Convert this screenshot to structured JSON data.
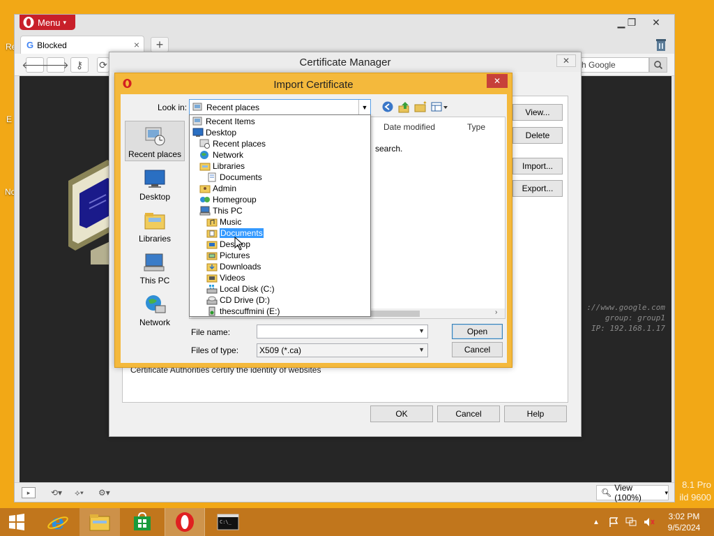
{
  "desktop": {
    "left_edge_labels": [
      "Re",
      "E",
      "No"
    ],
    "watermark": {
      "line1": "8.1 Pro",
      "line2": "ild 9600"
    }
  },
  "browser": {
    "menu_label": "Menu",
    "tab": {
      "title": "Blocked"
    },
    "search": {
      "text": "h Google"
    },
    "content": {
      "terminal_lines": [
        "://www.google.com",
        "group: group1",
        "IP: 192.168.1.17"
      ]
    },
    "statusbar": {
      "zoom_label": "View (100%)"
    }
  },
  "cert_manager": {
    "title": "Certificate Manager",
    "side_buttons": {
      "view": "View...",
      "delete": "Delete",
      "import": "Import...",
      "export": "Export..."
    },
    "description": "Certificate Authorities certify the identity of websites",
    "buttons": {
      "ok": "OK",
      "cancel": "Cancel",
      "help": "Help"
    }
  },
  "import_dialog": {
    "title": "Import Certificate",
    "look_in_label": "Look in:",
    "look_in_value": "Recent places",
    "places": [
      {
        "label": "Recent places",
        "icon": "recent-places-icon"
      },
      {
        "label": "Desktop",
        "icon": "desktop-icon"
      },
      {
        "label": "Libraries",
        "icon": "libraries-icon"
      },
      {
        "label": "This PC",
        "icon": "this-pc-icon"
      },
      {
        "label": "Network",
        "icon": "network-icon"
      }
    ],
    "columns": {
      "date_modified": "Date modified",
      "type": "Type"
    },
    "list_message": "search.",
    "file_name_label": "File name:",
    "file_name_value": "",
    "files_of_type_label": "Files of type:",
    "files_of_type_value": "X509 (*.ca)",
    "buttons": {
      "open": "Open",
      "cancel": "Cancel"
    }
  },
  "look_in_dropdown": {
    "items": [
      {
        "label": "Recent Items",
        "icon": "recent-items-icon",
        "level": 0
      },
      {
        "label": "Desktop",
        "icon": "desktop-icon",
        "level": 0
      },
      {
        "label": "Recent places",
        "icon": "recent-places-icon",
        "level": 1
      },
      {
        "label": "Network",
        "icon": "network-icon",
        "level": 1
      },
      {
        "label": "Libraries",
        "icon": "libraries-icon",
        "level": 1
      },
      {
        "label": "Documents",
        "icon": "documents-icon",
        "level": 2
      },
      {
        "label": "Admin",
        "icon": "user-folder-icon",
        "level": 1
      },
      {
        "label": "Homegroup",
        "icon": "homegroup-icon",
        "level": 1
      },
      {
        "label": "This PC",
        "icon": "this-pc-icon",
        "level": 1
      },
      {
        "label": "Music",
        "icon": "music-folder-icon",
        "level": 2
      },
      {
        "label": "Documents",
        "icon": "documents-folder-icon",
        "level": 2,
        "selected": true
      },
      {
        "label": "Desktop",
        "icon": "desktop-folder-icon",
        "level": 2
      },
      {
        "label": "Pictures",
        "icon": "pictures-folder-icon",
        "level": 2
      },
      {
        "label": "Downloads",
        "icon": "downloads-folder-icon",
        "level": 2
      },
      {
        "label": "Videos",
        "icon": "videos-folder-icon",
        "level": 2
      },
      {
        "label": "Local Disk (C:)",
        "icon": "local-disk-icon",
        "level": 2
      },
      {
        "label": "CD Drive (D:)",
        "icon": "cd-drive-icon",
        "level": 2
      },
      {
        "label": "thescuffmini (E:)",
        "icon": "usb-drive-icon",
        "level": 2
      }
    ]
  },
  "taskbar": {
    "apps": [
      {
        "name": "internet-explorer-icon"
      },
      {
        "name": "file-explorer-icon"
      },
      {
        "name": "store-icon"
      },
      {
        "name": "opera-icon",
        "active": true
      },
      {
        "name": "command-prompt-icon"
      }
    ],
    "clock": {
      "time": "3:02 PM",
      "date": "9/5/2024"
    }
  },
  "colors": {
    "desktop_bg": "#f2a816",
    "taskbar": "#c1761c",
    "dialog_frame": "#f4b93c",
    "selection": "#3399ff",
    "opera_red": "#c8202a"
  }
}
